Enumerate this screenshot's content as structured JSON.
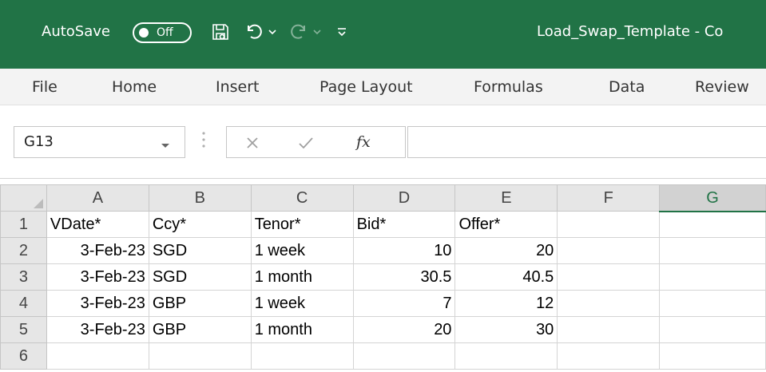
{
  "titlebar": {
    "autosave_label": "AutoSave",
    "autosave_state": "Off",
    "icons": [
      "save-icon",
      "undo-icon",
      "undo-dropdown-icon",
      "redo-icon",
      "redo-dropdown-icon",
      "customize-qat-icon"
    ],
    "document_title": "Load_Swap_Template  -  Co",
    "color": "#217346"
  },
  "ribbon": {
    "tabs": [
      "File",
      "Home",
      "Insert",
      "Page Layout",
      "Formulas",
      "Data",
      "Review"
    ]
  },
  "formula_bar": {
    "name_box": "G13",
    "fx_label": "fx",
    "formula": ""
  },
  "sheet": {
    "columns": [
      "A",
      "B",
      "C",
      "D",
      "E",
      "F",
      "G"
    ],
    "selected_column": "G",
    "rows": [
      {
        "num": "1",
        "cells": [
          "VDate*",
          "Ccy*",
          "Tenor*",
          "Bid*",
          "Offer*",
          "",
          ""
        ]
      },
      {
        "num": "2",
        "cells": [
          "3-Feb-23",
          "SGD",
          "1 week",
          "10",
          "20",
          "",
          ""
        ]
      },
      {
        "num": "3",
        "cells": [
          "3-Feb-23",
          "SGD",
          "1 month",
          "30.5",
          "40.5",
          "",
          ""
        ]
      },
      {
        "num": "4",
        "cells": [
          "3-Feb-23",
          "GBP",
          "1 week",
          "7",
          "12",
          "",
          ""
        ]
      },
      {
        "num": "5",
        "cells": [
          "3-Feb-23",
          "GBP",
          "1 month",
          "20",
          "30",
          "",
          ""
        ]
      },
      {
        "num": "6",
        "cells": [
          "",
          "",
          "",
          "",
          "",
          "",
          ""
        ]
      }
    ]
  }
}
